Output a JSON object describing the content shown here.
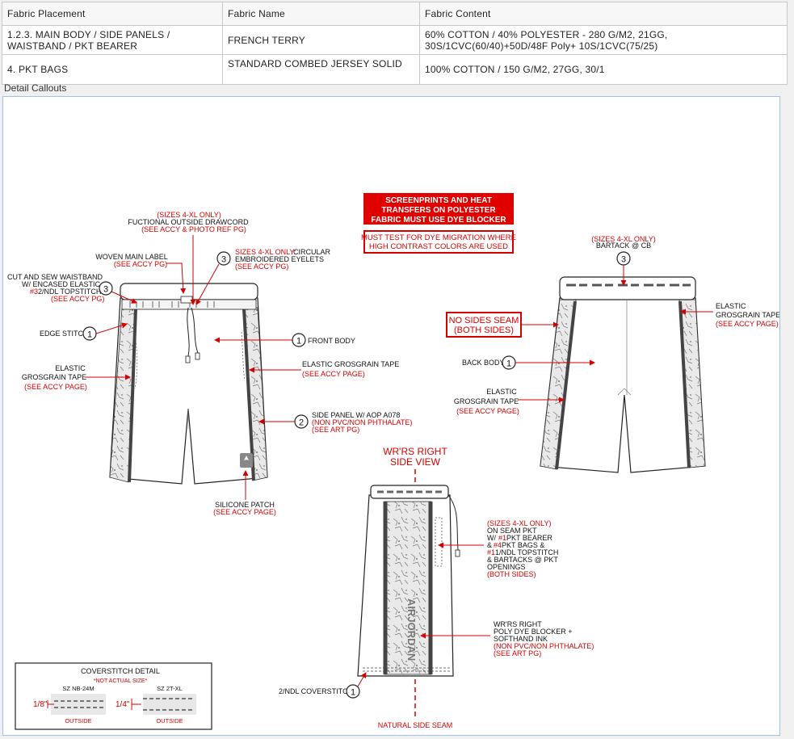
{
  "table": {
    "headers": [
      "Fabric Placement",
      "Fabric Name",
      "Fabric Content"
    ],
    "rows": [
      {
        "placement": [
          "1.2.3. MAIN BODY / SIDE PANELS /",
          "WAISTBAND / PKT BEARER"
        ],
        "name": "FRENCH TERRY",
        "content": [
          "60% COTTON / 40% POLYESTER - 280 G/M2, 21GG,",
          "30S/1CVC(60/40)+50D/48F Poly+ 10S/1CVC(75/25)"
        ]
      },
      {
        "placement": [
          "4. PKT BAGS"
        ],
        "name": "STANDARD COMBED JERSEY SOLID",
        "content": [
          "100% COTTON / 150 G/M2, 27GG, 30/1"
        ]
      }
    ]
  },
  "section_title": "Detail Callouts",
  "warning": {
    "box1": [
      "SCREENPRINTS AND HEAT",
      "TRANSFERS ON POLYESTER",
      "FABRIC MUST USE DYE BLOCKER"
    ],
    "box2": [
      "MUST TEST FOR DYE MIGRATION WHERE",
      "HIGH CONTRAST COLORS ARE USED"
    ]
  },
  "front": {
    "drawcord": {
      "red": "(SIZES 4-XL ONLY)",
      "black": "FUCTIONAL OUTSIDE DRAWCORD",
      "red2": "(SEE ACCY & PHOTO REF PG)"
    },
    "woven_label": {
      "black": "WOVEN MAIN LABEL",
      "red": "(SEE ACCY PG)"
    },
    "eyelets": {
      "num": "3",
      "red": "SIZES 4-XL ONLY:",
      "black1": " CIRCULAR",
      "black2": "EMBROIDERED EYELETS",
      "red2": "(SEE ACCY PG)"
    },
    "waistband": {
      "num": "3",
      "black1": "CUT AND SEW  WAISTBAND",
      "black2": "W/ ENCASED ELASTIC +",
      "red_num": "#3",
      "black3": " 2/NDL TOPSTITCH",
      "red": "(SEE ACCY PG)"
    },
    "edge": {
      "num": "1",
      "black": "EDGE STITCH"
    },
    "front_body": {
      "num": "1",
      "black": "FRONT BODY"
    },
    "tape_left": {
      "black1": "ELASTIC",
      "black2": "GROSGRAIN TAPE",
      "red": "(SEE ACCY PAGE)"
    },
    "tape_right": {
      "black": "ELASTIC GROSGRAIN TAPE",
      "red": "(SEE ACCY PAGE)"
    },
    "side_panel": {
      "num": "2",
      "black": "SIDE PANEL W/ AOP A078",
      "red1": "(NON PVC/NON PHTHALATE)",
      "red2": "(SEE ART PG)"
    },
    "silicone": {
      "black": "SILICONE PATCH",
      "red": "(SEE ACCY PAGE)"
    }
  },
  "back": {
    "bartack": {
      "red": "(SIZES 4-XL ONLY)",
      "black": "BARTACK @ CB",
      "num": "3"
    },
    "no_seam": [
      "NO SIDES SEAM",
      "(BOTH SIDES)"
    ],
    "tape_right": {
      "black1": "ELASTIC",
      "black2": "GROSGRAIN TAPE",
      "red": "(SEE ACCY PAGE)"
    },
    "back_body": {
      "num": "1",
      "black": "BACK BODY"
    },
    "tape_left": {
      "black1": "ELASTIC",
      "black2": "GROSGRAIN TAPE",
      "red": "(SEE ACCY PAGE)"
    }
  },
  "side": {
    "title": [
      "WR'RS RIGHT",
      "SIDE VIEW"
    ],
    "pocket": {
      "red1": "(SIZES 4-XL ONLY)",
      "l2": "ON SEAM PKT",
      "l3a": "W/ ",
      "l3r": "#1",
      "l3b": " PKT BEARER",
      "l4a": "& ",
      "l4r": "#4",
      "l4b": "  PKT BAGS &",
      "l5r": "#1",
      "l5b": " 1/NDL TOPSTITCH",
      "l6": "& BARTACKS @ PKT",
      "l7": "OPENINGS",
      "red2": "(BOTH SIDES)"
    },
    "print": {
      "l1": "WR'RS RIGHT",
      "l2": "POLY DYE BLOCKER +",
      "l3": "SOFTHAND INK",
      "red1": "(NON PVC/NON PHTHALATE)",
      "red2": "(SEE ART PG)"
    },
    "cover": {
      "num": "1",
      "black": "2/NDL COVERSTITCH"
    },
    "seam": "NATURAL SIDE SEAM",
    "brand": "AIRJORDAN"
  },
  "coverstitch": {
    "title": "COVERSTITCH DETAIL",
    "note": "*NOT ACTUAL SIZE*",
    "size1": "SZ NB-24M",
    "size2": "SZ 2T-XL",
    "m1": "1/8\"",
    "m2": "1/4\"",
    "outside1": "OUTSIDE",
    "outside2": "OUTSIDE"
  },
  "colors": {
    "red": "#d40000",
    "panel_border": "#9fc3e8"
  }
}
